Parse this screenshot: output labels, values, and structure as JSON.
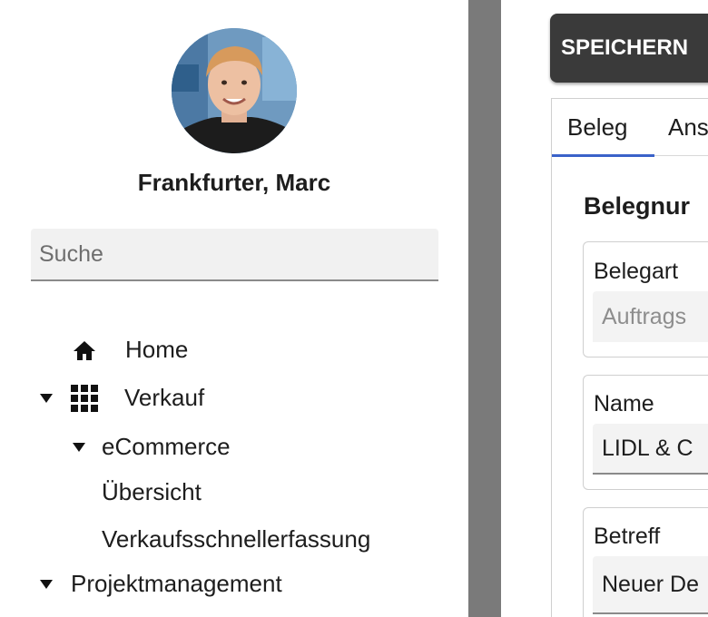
{
  "user": {
    "name": "Frankfurter, Marc"
  },
  "search": {
    "placeholder": "Suche"
  },
  "nav": {
    "home": "Home",
    "sales": "Verkauf",
    "ecommerce": "eCommerce",
    "overview": "Übersicht",
    "quick_entry": "Verkaufsschnellerfassung",
    "project_management": "Projektmanagement"
  },
  "toolbar": {
    "save_label": "SPEICHERN"
  },
  "tabs": [
    {
      "label": "Beleg"
    },
    {
      "label": "Ans"
    }
  ],
  "form": {
    "section_title": "Belegnur",
    "fields": [
      {
        "label": "Belegart",
        "value": "Auftrags"
      },
      {
        "label": "Name",
        "value": "LIDL & C"
      },
      {
        "label": "Betreff",
        "value": "Neuer De"
      }
    ]
  },
  "colors": {
    "accent": "#3a62c9",
    "button": "#3a3a3a",
    "divider": "#7a7a7a"
  }
}
